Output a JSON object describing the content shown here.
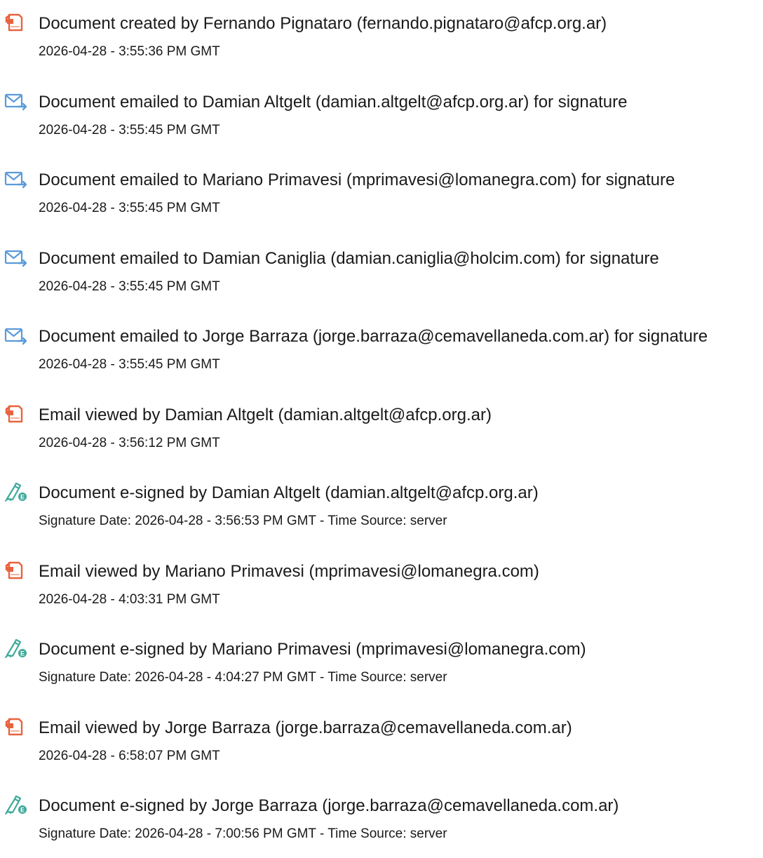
{
  "colors": {
    "document_icon": "#e8633f",
    "email_icon": "#5a9bd8",
    "signature_icon": "#3fa99a",
    "text": "#1a1a1a"
  },
  "events": [
    {
      "icon": "document-icon",
      "title": "Document created by Fernando Pignataro (fernando.pignataro@afcp.org.ar)",
      "detail": "2026-04-28 - 3:55:36 PM GMT"
    },
    {
      "icon": "email-sent-icon",
      "title": "Document emailed to Damian Altgelt (damian.altgelt@afcp.org.ar) for signature",
      "detail": "2026-04-28 - 3:55:45 PM GMT"
    },
    {
      "icon": "email-sent-icon",
      "title": "Document emailed to Mariano Primavesi (mprimavesi@lomanegra.com) for signature",
      "detail": "2026-04-28 - 3:55:45 PM GMT"
    },
    {
      "icon": "email-sent-icon",
      "title": "Document emailed to Damian Caniglia (damian.caniglia@holcim.com) for signature",
      "detail": "2026-04-28 - 3:55:45 PM GMT"
    },
    {
      "icon": "email-sent-icon",
      "title": "Document emailed to Jorge Barraza (jorge.barraza@cemavellaneda.com.ar) for signature",
      "detail": "2026-04-28 - 3:55:45 PM GMT"
    },
    {
      "icon": "document-icon",
      "title": "Email viewed by Damian Altgelt (damian.altgelt@afcp.org.ar)",
      "detail": "2026-04-28 - 3:56:12 PM GMT"
    },
    {
      "icon": "e-signature-icon",
      "title": "Document e-signed by Damian Altgelt (damian.altgelt@afcp.org.ar)",
      "detail": "Signature Date: 2026-04-28 - 3:56:53 PM GMT - Time Source: server"
    },
    {
      "icon": "document-icon",
      "title": "Email viewed by Mariano Primavesi (mprimavesi@lomanegra.com)",
      "detail": "2026-04-28 - 4:03:31 PM GMT"
    },
    {
      "icon": "e-signature-icon",
      "title": "Document e-signed by Mariano Primavesi (mprimavesi@lomanegra.com)",
      "detail": "Signature Date: 2026-04-28 - 4:04:27 PM GMT - Time Source: server"
    },
    {
      "icon": "document-icon",
      "title": "Email viewed by Jorge Barraza (jorge.barraza@cemavellaneda.com.ar)",
      "detail": "2026-04-28 - 6:58:07 PM GMT"
    },
    {
      "icon": "e-signature-icon",
      "title": "Document e-signed by Jorge Barraza (jorge.barraza@cemavellaneda.com.ar)",
      "detail": "Signature Date: 2026-04-28 - 7:00:56 PM GMT - Time Source: server"
    }
  ]
}
